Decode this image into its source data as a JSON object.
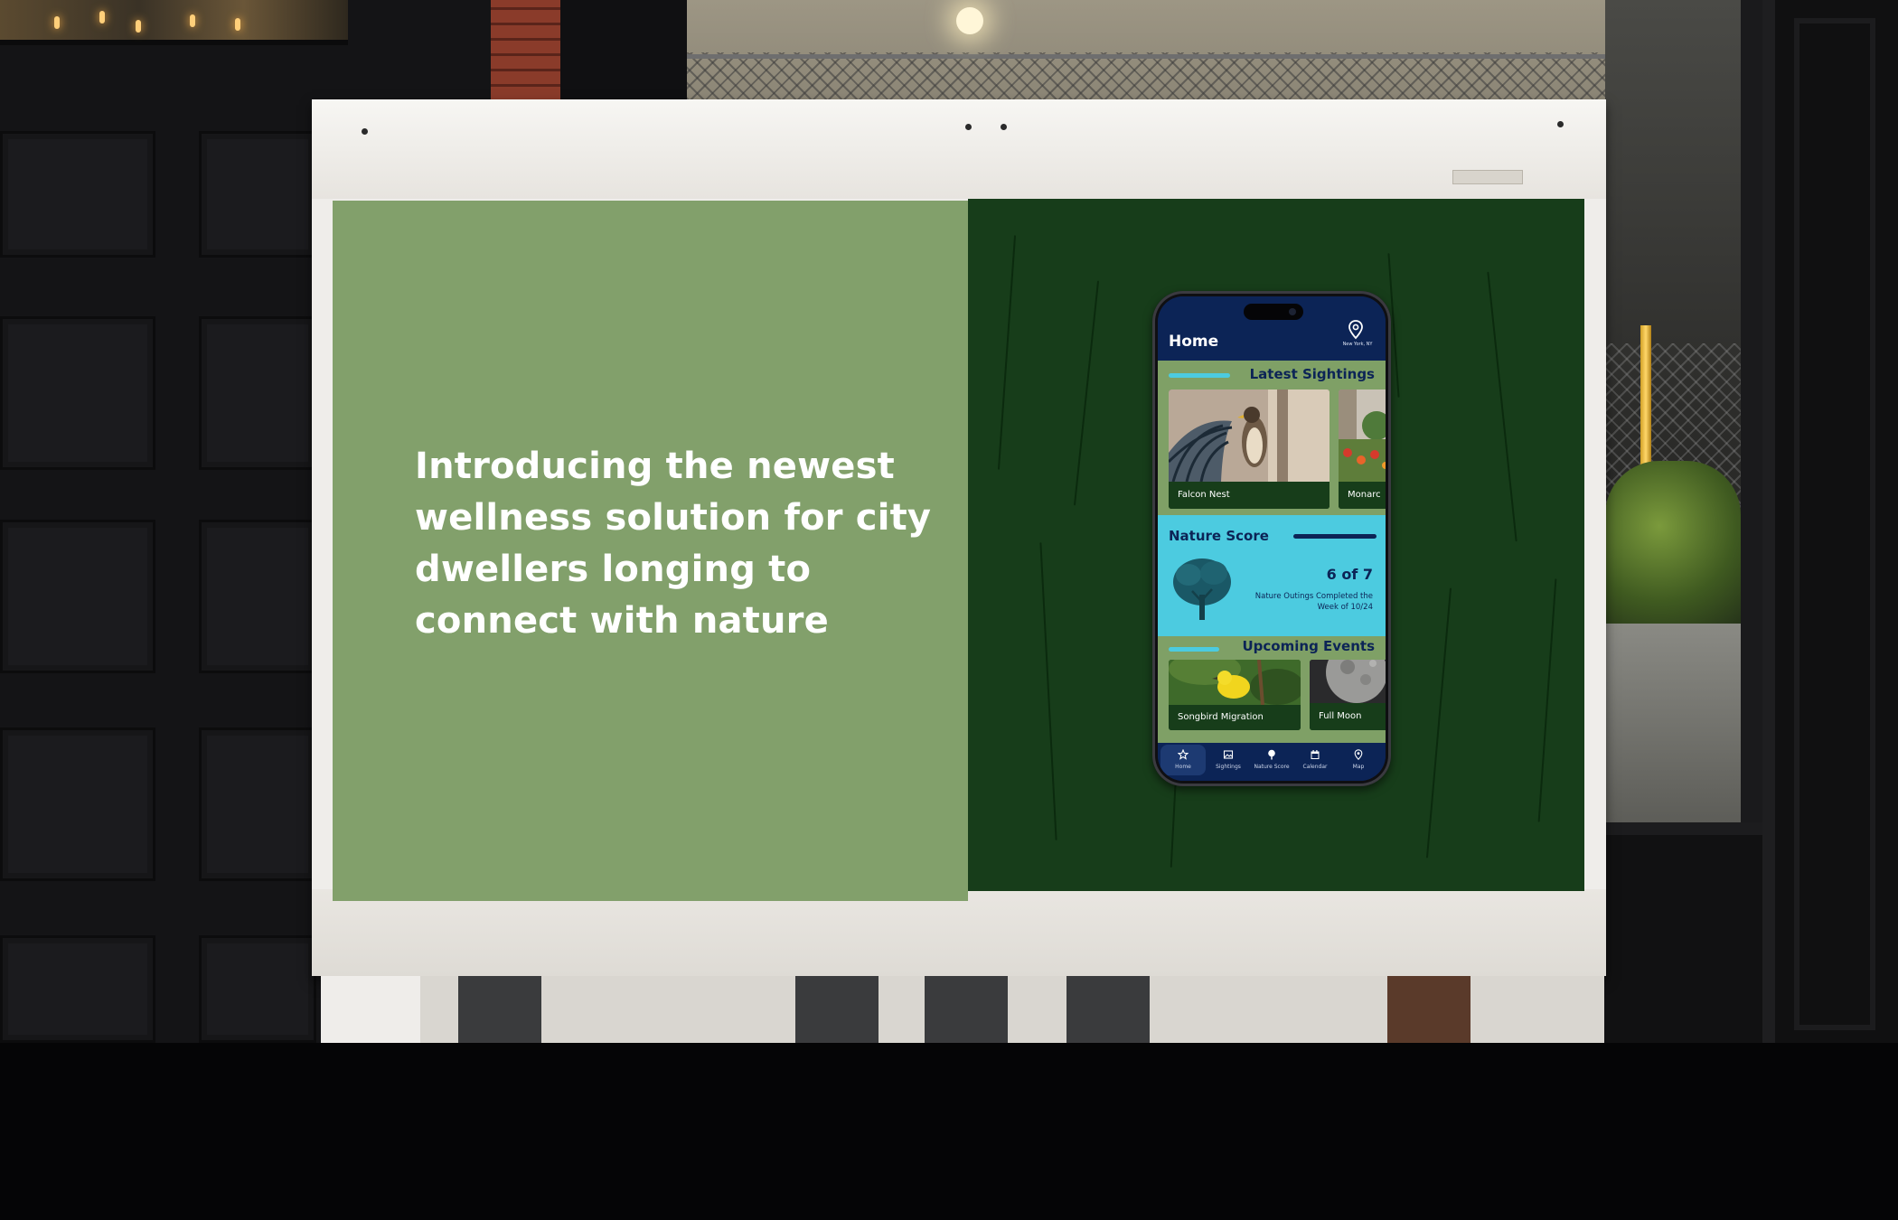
{
  "poster": {
    "headline": "Introducing the newest wellness solution for city dwellers longing to connect with nature",
    "left_panel_color": "#82a06b",
    "right_panel_color": "#173d1a"
  },
  "app": {
    "header": {
      "title": "Home",
      "location": "New York, NY",
      "location_icon": "map-pin-icon"
    },
    "latest_sightings": {
      "title": "Latest Sightings",
      "cards": [
        {
          "label": "Falcon Nest",
          "image": "falcon-on-balcony-photo"
        },
        {
          "label": "Monarc",
          "image": "street-flowers-photo"
        }
      ]
    },
    "nature_score": {
      "title": "Nature Score",
      "value": "6 of 7",
      "caption": "Nature Outings Completed the Week of 10/24",
      "icon": "tree-icon"
    },
    "upcoming_events": {
      "title": "Upcoming Events",
      "cards": [
        {
          "label": "Songbird Migration",
          "image": "yellow-songbird-photo"
        },
        {
          "label": "Full Moon",
          "image": "moon-photo"
        }
      ]
    },
    "tabs": [
      {
        "label": "Home",
        "icon": "star-icon",
        "active": true
      },
      {
        "label": "Sightings",
        "icon": "image-icon",
        "active": false
      },
      {
        "label": "Nature Score",
        "icon": "tree-small-icon",
        "active": false
      },
      {
        "label": "Calendar",
        "icon": "calendar-icon",
        "active": false
      },
      {
        "label": "Map",
        "icon": "map-pin-icon",
        "active": false
      }
    ],
    "colors": {
      "navy": "#0c2456",
      "sage": "#7fa066",
      "cyan": "#4ccbe0",
      "forest": "#173d1a"
    }
  }
}
